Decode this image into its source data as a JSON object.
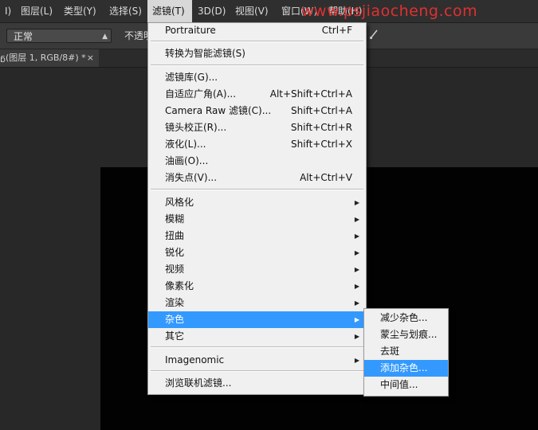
{
  "menubar": {
    "items": [
      {
        "label": "I)"
      },
      {
        "label": "图层(L)"
      },
      {
        "label": "类型(Y)"
      },
      {
        "label": "选择(S)"
      },
      {
        "label": "滤镜(T)",
        "active": true
      },
      {
        "label": "3D(D)"
      },
      {
        "label": "视图(V)"
      },
      {
        "label": "窗口(W)"
      },
      {
        "label": "帮助(H)"
      }
    ],
    "watermark": "www.psjiaocheng.com"
  },
  "options": {
    "mode_value": "正常",
    "opacity_label": "不透明"
  },
  "document_tab": {
    "label": "ᵷ(图层 1, RGB/8#) *",
    "close": "×"
  },
  "filter_menu": {
    "groups": [
      [
        {
          "label": "Portraiture",
          "shortcut": "Ctrl+F"
        }
      ],
      [
        {
          "label": "转换为智能滤镜(S)"
        }
      ],
      [
        {
          "label": "滤镜库(G)..."
        },
        {
          "label": "自适应广角(A)...",
          "shortcut": "Alt+Shift+Ctrl+A"
        },
        {
          "label": "Camera Raw 滤镜(C)...",
          "shortcut": "Shift+Ctrl+A"
        },
        {
          "label": "镜头校正(R)...",
          "shortcut": "Shift+Ctrl+R"
        },
        {
          "label": "液化(L)...",
          "shortcut": "Shift+Ctrl+X"
        },
        {
          "label": "油画(O)..."
        },
        {
          "label": "消失点(V)...",
          "shortcut": "Alt+Ctrl+V"
        }
      ],
      [
        {
          "label": "风格化",
          "submenu": true
        },
        {
          "label": "模糊",
          "submenu": true
        },
        {
          "label": "扭曲",
          "submenu": true
        },
        {
          "label": "锐化",
          "submenu": true
        },
        {
          "label": "视频",
          "submenu": true
        },
        {
          "label": "像素化",
          "submenu": true
        },
        {
          "label": "渲染",
          "submenu": true
        },
        {
          "label": "杂色",
          "submenu": true,
          "highlighted": true
        },
        {
          "label": "其它",
          "submenu": true
        }
      ],
      [
        {
          "label": "Imagenomic",
          "submenu": true
        }
      ],
      [
        {
          "label": "浏览联机滤镜..."
        }
      ]
    ],
    "submenu_arrow": "▶"
  },
  "noise_submenu": {
    "items": [
      {
        "label": "减少杂色..."
      },
      {
        "label": "蒙尘与划痕..."
      },
      {
        "label": "去斑"
      },
      {
        "label": "添加杂色...",
        "highlighted": true
      },
      {
        "label": "中间值..."
      }
    ]
  }
}
